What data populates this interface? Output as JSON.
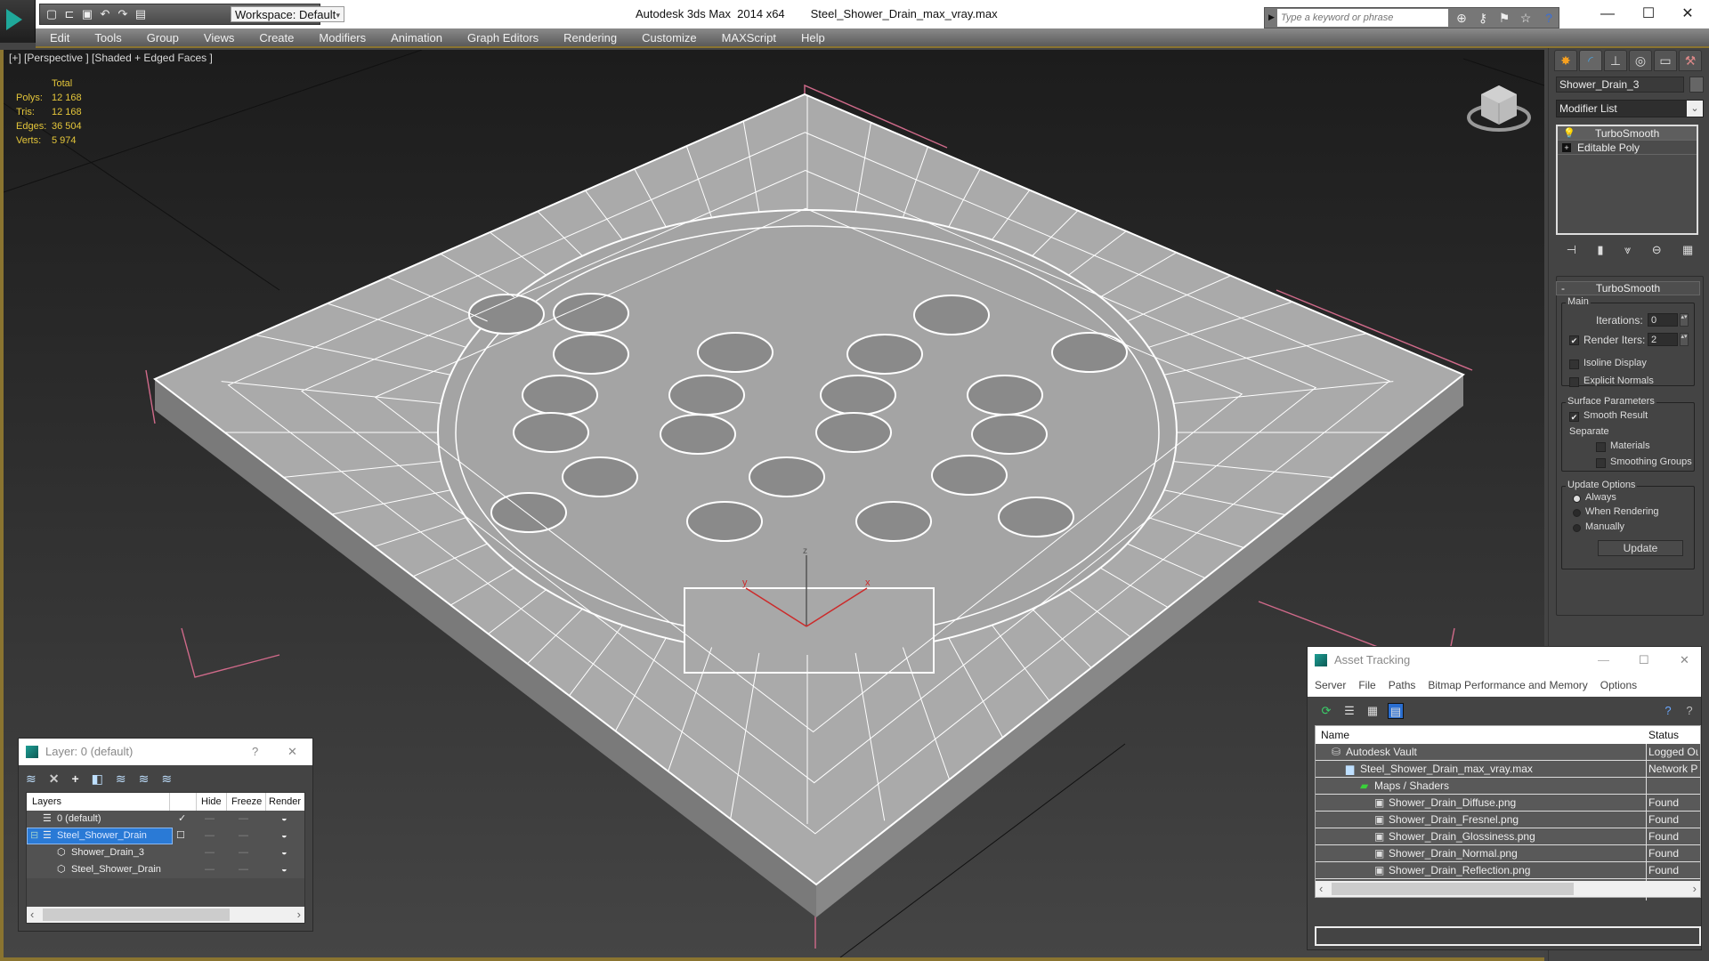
{
  "titlebar": {
    "app_title": "Autodesk 3ds Max  2014 x64",
    "file_title": "Steel_Shower_Drain_max_vray.max",
    "workspace": "Workspace: Default",
    "search_placeholder": "Type a keyword or phrase",
    "quick_icons": [
      "new-file-icon",
      "open-file-icon",
      "save-icon",
      "undo-icon",
      "redo-icon",
      "project-folder-icon"
    ]
  },
  "menu": [
    "Edit",
    "Tools",
    "Group",
    "Views",
    "Create",
    "Modifiers",
    "Animation",
    "Graph Editors",
    "Rendering",
    "Customize",
    "MAXScript",
    "Help"
  ],
  "viewport": {
    "label": "[+] [Perspective ] [Shaded + Edged Faces ]",
    "stats": {
      "header": "Total",
      "rows": [
        {
          "k": "Polys:",
          "v": "12 168"
        },
        {
          "k": "Tris:",
          "v": "12 168"
        },
        {
          "k": "Edges:",
          "v": "36 504"
        },
        {
          "k": "Verts:",
          "v": "5 974"
        }
      ]
    },
    "gizmo": {
      "x": "x",
      "y": "y",
      "z": "z"
    },
    "colors": {
      "mesh": "#a9a9a9",
      "wire": "#ffffff",
      "axis": "#cc2a2a",
      "stats": "#e4c63a",
      "frame": "#8a7430"
    }
  },
  "command_panel": {
    "tabs": [
      "create-tab",
      "modify-tab",
      "hierarchy-tab",
      "motion-tab",
      "display-tab",
      "utilities-tab"
    ],
    "object_name": "Shower_Drain_3",
    "modifier_list": "Modifier List",
    "stack": [
      {
        "label": "TurboSmooth",
        "active": true
      },
      {
        "label": "Editable Poly",
        "active": false
      }
    ],
    "turbosmooth": {
      "title": "TurboSmooth",
      "main_title": "Main",
      "iterations_label": "Iterations:",
      "iterations": "0",
      "render_iters_label": "Render Iters:",
      "render_iters": "2",
      "render_iters_checked": true,
      "isoline": "Isoline Display",
      "explicit_normals": "Explicit Normals",
      "surface_title": "Surface Parameters",
      "smooth_result": "Smooth Result",
      "separate": "Separate",
      "materials": "Materials",
      "smoothing_groups": "Smoothing Groups",
      "update_title": "Update Options",
      "always": "Always",
      "when_rendering": "When Rendering",
      "manually": "Manually",
      "update_btn": "Update",
      "selected_update": "Always"
    }
  },
  "layer_dialog": {
    "title": "Layer: 0 (default)",
    "help": "?",
    "columns": [
      "Layers",
      "",
      "Hide",
      "Freeze",
      "Render"
    ],
    "rows": [
      {
        "name": "0 (default)",
        "current": "✓",
        "selected": false,
        "indent": 1
      },
      {
        "name": "Steel_Shower_Drain",
        "current": "☐",
        "selected": true,
        "indent": 0
      },
      {
        "name": "Shower_Drain_3",
        "current": "",
        "selected": false,
        "indent": 2
      },
      {
        "name": "Steel_Shower_Drain",
        "current": "",
        "selected": false,
        "indent": 2
      }
    ]
  },
  "asset_dialog": {
    "title": "Asset Tracking",
    "menu": [
      "Server",
      "File",
      "Paths",
      "Bitmap Performance and Memory",
      "Options"
    ],
    "columns": [
      "Name",
      "Status"
    ],
    "rows": [
      {
        "name": "Autodesk Vault",
        "status": "Logged Ou",
        "indent": 1
      },
      {
        "name": "Steel_Shower_Drain_max_vray.max",
        "status": "Network P",
        "indent": 2
      },
      {
        "name": "Maps / Shaders",
        "status": "",
        "indent": 3
      },
      {
        "name": "Shower_Drain_Diffuse.png",
        "status": "Found",
        "indent": 4
      },
      {
        "name": "Shower_Drain_Fresnel.png",
        "status": "Found",
        "indent": 4
      },
      {
        "name": "Shower_Drain_Glossiness.png",
        "status": "Found",
        "indent": 4
      },
      {
        "name": "Shower_Drain_Normal.png",
        "status": "Found",
        "indent": 4
      },
      {
        "name": "Shower_Drain_Reflection.png",
        "status": "Found",
        "indent": 4
      }
    ]
  }
}
